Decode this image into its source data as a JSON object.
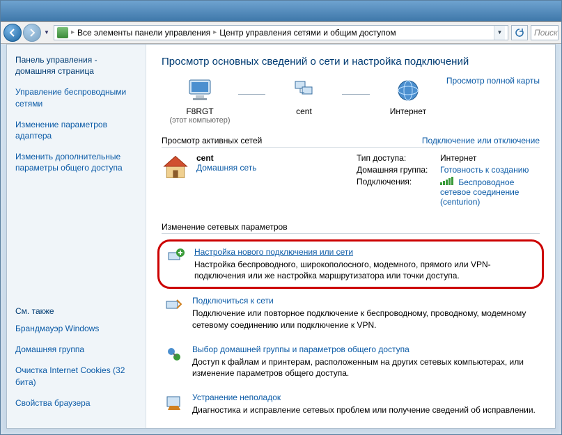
{
  "toolbar": {
    "breadcrumb_root": "Все элементы панели управления",
    "breadcrumb_current": "Центр управления сетями и общим доступом",
    "search_placeholder": "Поиск"
  },
  "sidebar": {
    "home1": "Панель управления -",
    "home2": "домашняя страница",
    "links": [
      "Управление беспроводными сетями",
      "Изменение параметров адаптера",
      "Изменить дополнительные параметры общего доступа"
    ],
    "see_also_title": "См. также",
    "see_also": [
      "Брандмауэр Windows",
      "Домашняя группа",
      "Очистка Internet Cookies (32 бита)",
      "Свойства браузера"
    ]
  },
  "main": {
    "title": "Просмотр основных сведений о сети и настройка подключений",
    "full_map": "Просмотр полной карты",
    "map": {
      "node1_label": "F8RGT",
      "node1_sub": "(этот компьютер)",
      "node2_label": "cent",
      "node3_label": "Интернет"
    },
    "active_title": "Просмотр активных сетей",
    "active_link": "Подключение или отключение",
    "net": {
      "name": "cent",
      "type": "Домашняя сеть",
      "p1_label": "Тип доступа:",
      "p1_value": "Интернет",
      "p2_label": "Домашняя группа:",
      "p2_value": "Готовность к созданию",
      "p3_label": "Подключения:",
      "p3_value": "Беспроводное сетевое соединение (centurion)"
    },
    "settings_title": "Изменение сетевых параметров",
    "tasks": [
      {
        "title": "Настройка нового подключения или сети",
        "desc": "Настройка беспроводного, широкополосного, модемного, прямого или VPN-подключения или же настройка маршрутизатора или точки доступа."
      },
      {
        "title": "Подключиться к сети",
        "desc": "Подключение или повторное подключение к беспроводному, проводному, модемному сетевому соединению или подключение к VPN."
      },
      {
        "title": "Выбор домашней группы и параметров общего доступа",
        "desc": "Доступ к файлам и принтерам, расположенным на других сетевых компьютерах, или изменение параметров общего доступа."
      },
      {
        "title": "Устранение неполадок",
        "desc": "Диагностика и исправление сетевых проблем или получение сведений об исправлении."
      }
    ]
  }
}
